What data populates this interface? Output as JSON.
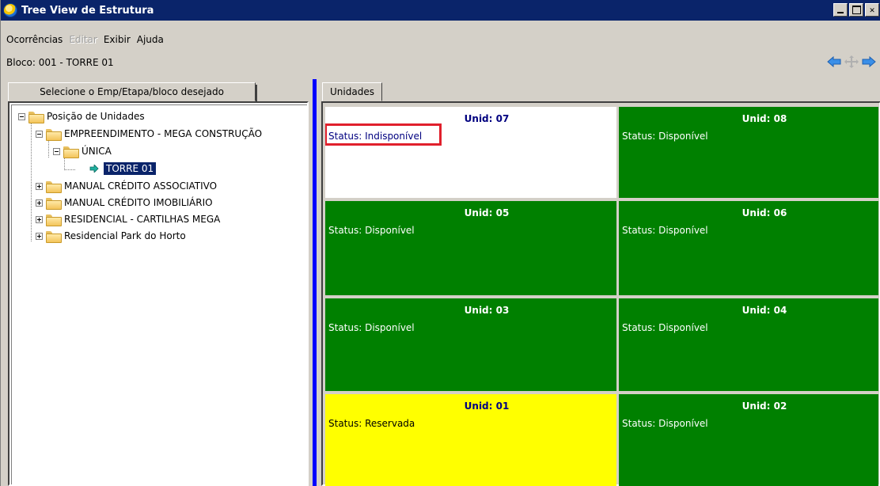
{
  "window": {
    "title": "Tree View de Estrutura",
    "controls": [
      "minimize",
      "maximize",
      "close"
    ],
    "close_glyph": "✕"
  },
  "menu": {
    "items": [
      {
        "label": "Ocorrências",
        "enabled": true
      },
      {
        "label": "Editar",
        "enabled": false
      },
      {
        "label": "Exibir",
        "enabled": true
      },
      {
        "label": "Ajuda",
        "enabled": true
      }
    ]
  },
  "bloco": {
    "label": "Bloco: 001 - TORRE 01"
  },
  "nav": {
    "icons": [
      "arrow-left-icon",
      "move-icon",
      "arrow-right-icon"
    ]
  },
  "left_panel": {
    "tab_label": "Selecione o Emp/Etapa/bloco desejado",
    "tree": {
      "root": "Posição de Unidades",
      "empreendimento": "EMPREENDIMENTO - MEGA CONSTRUÇÃO",
      "etapa": "ÚNICA",
      "bloco": "TORRE 01",
      "others": [
        "MANUAL CRÉDITO ASSOCIATIVO",
        "MANUAL CRÉDITO IMOBILIÁRIO",
        "RESIDENCIAL - CARTILHAS MEGA",
        "Residencial Park do Horto"
      ]
    }
  },
  "right_panel": {
    "tab_label": "Unidades",
    "units": [
      {
        "title": "Unid: 07",
        "status": "Status: Indisponível",
        "color": "white",
        "highlighted": true
      },
      {
        "title": "Unid: 08",
        "status": "Status: Disponível",
        "color": "green"
      },
      {
        "title": "Unid: 05",
        "status": "Status: Disponível",
        "color": "green"
      },
      {
        "title": "Unid: 06",
        "status": "Status: Disponível",
        "color": "green"
      },
      {
        "title": "Unid: 03",
        "status": "Status: Disponível",
        "color": "green"
      },
      {
        "title": "Unid: 04",
        "status": "Status: Disponível",
        "color": "green"
      },
      {
        "title": "Unid: 01",
        "status": "Status: Reservada",
        "color": "yellow"
      },
      {
        "title": "Unid: 02",
        "status": "Status: Disponível",
        "color": "green"
      }
    ]
  },
  "colors": {
    "titlebar": "#0a246a",
    "divider": "#0000ff",
    "available": "#008000",
    "reserved": "#ffff00",
    "unavailable": "#ffffff",
    "highlight": "#e0202c"
  }
}
